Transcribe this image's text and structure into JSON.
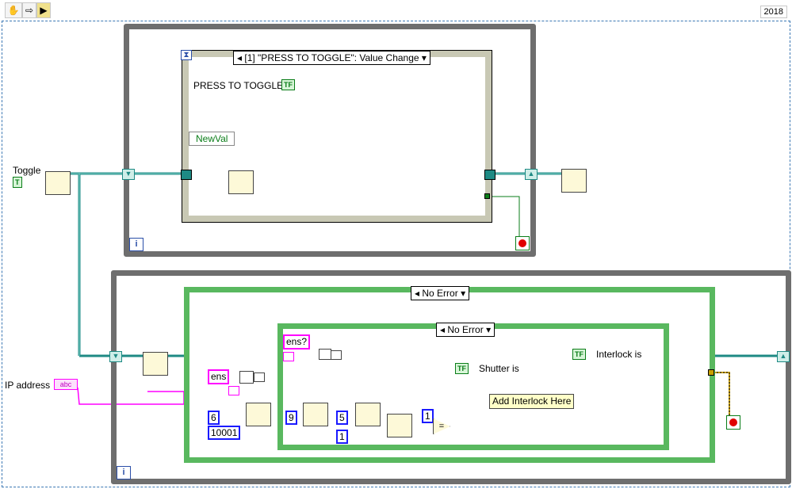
{
  "toolbar": {
    "run_icon": "hand-icon",
    "arrow_icon": "arrow-icon",
    "version": "2018"
  },
  "labels": {
    "toggle_control": "Toggle",
    "ip_control": "IP address",
    "press_to_toggle": "PRESS TO TOGGLE",
    "newval": "NewVal",
    "shutter": "Shutter is",
    "interlock": "Interlock  is",
    "add_interlock": "Add Interlock Here"
  },
  "selectors": {
    "event_case": "[1] \"PRESS TO TOGGLE\": Value Change",
    "outer_case": "No Error",
    "inner_case": "No Error"
  },
  "constants": {
    "ens": "ens",
    "ens_q": "ens?",
    "num6": "6",
    "num10001": "10001",
    "num9": "9",
    "num5": "5",
    "num1a": "1",
    "num1b": "1"
  },
  "terminals": {
    "bool": "TF",
    "str": "abc",
    "loop_iter": "i",
    "toggle_bool": "T"
  },
  "colors": {
    "bool_wire": "#0a7d18",
    "string_wire": "#ff00ff",
    "cluster_wire": "#1e8a84",
    "numeric": "#1a1aff",
    "error_wire": "#c8a000"
  }
}
